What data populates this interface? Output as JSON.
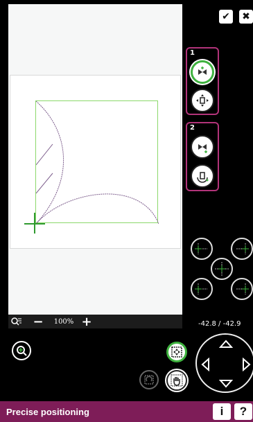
{
  "toolbar": {
    "confirm_icon": "check-icon",
    "close_icon": "close-icon"
  },
  "groups": [
    {
      "number": "1",
      "buttons": [
        "move-icon",
        "move-in-hoop-icon"
      ]
    },
    {
      "number": "2",
      "buttons": [
        "rotate-move-icon",
        "rotate-icon"
      ]
    }
  ],
  "zoom": {
    "value": "100%"
  },
  "position_readout": "-42.8 / -42.9",
  "footer": {
    "title": "Precise positioning",
    "info_label": "i",
    "help_label": "?"
  },
  "colors": {
    "accent": "#7e1d58",
    "group_border": "#b2347a",
    "active_green": "#3fb23f",
    "design_box": "#8bd86a"
  }
}
